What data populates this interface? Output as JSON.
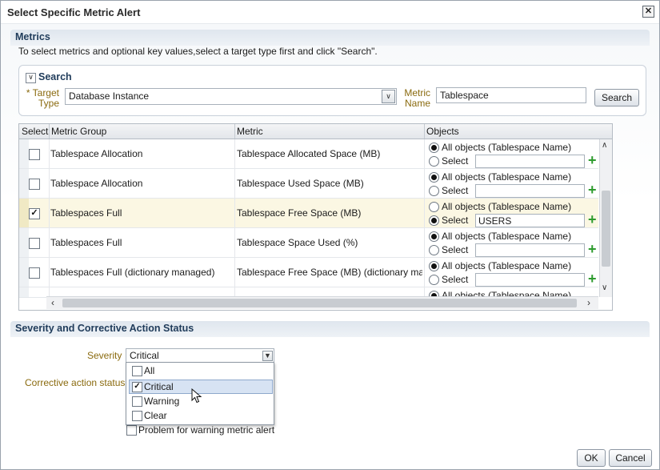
{
  "dialog": {
    "title": "Select Specific Metric Alert",
    "close_glyph": "✕"
  },
  "metrics": {
    "title": "Metrics",
    "instructions": "To select metrics and optional key values,select a target type first and click \"Search\".",
    "search": {
      "title": "Search",
      "toggle_glyph": "∨",
      "target_type_required": "*",
      "target_type_label_line1": "Target",
      "target_type_label_line2": "Type",
      "target_type_value": "Database Instance",
      "metric_name_label_line1": "Metric",
      "metric_name_label_line2": "Name",
      "metric_name_value": "Tablespace",
      "search_button": "Search"
    },
    "table": {
      "columns": [
        "Select",
        "Metric Group",
        "Metric",
        "Objects"
      ],
      "all_objects_label": "All objects (Tablespace Name)",
      "select_label": "Select",
      "rows": [
        {
          "checked": false,
          "group": "Tablespace Allocation",
          "metric": "Tablespace Allocated Space (MB)",
          "mode": "all",
          "value": ""
        },
        {
          "checked": false,
          "group": "Tablespace Allocation",
          "metric": "Tablespace Used Space (MB)",
          "mode": "all",
          "value": ""
        },
        {
          "checked": true,
          "group": "Tablespaces Full",
          "metric": "Tablespace Free Space (MB)",
          "mode": "select",
          "value": "USERS"
        },
        {
          "checked": false,
          "group": "Tablespaces Full",
          "metric": "Tablespace Space Used (%)",
          "mode": "all",
          "value": ""
        },
        {
          "checked": false,
          "group": "Tablespaces Full (dictionary managed)",
          "metric": "Tablespace Free Space (MB) (dictionary managed)",
          "mode": "all",
          "value": ""
        }
      ],
      "partial_row_label": "All objects (Tablespace Name)"
    }
  },
  "severity_section": {
    "title": "Severity and Corrective Action Status",
    "severity_label": "Severity",
    "severity_value": "Critical",
    "corrective_label": "Corrective action status",
    "options": [
      {
        "label": "All",
        "checked": false
      },
      {
        "label": "Critical",
        "checked": true
      },
      {
        "label": "Warning",
        "checked": false
      },
      {
        "label": "Clear",
        "checked": false
      }
    ],
    "warning_checkbox_label": "Problem for warning metric alert"
  },
  "footer": {
    "ok": "OK",
    "cancel": "Cancel"
  }
}
